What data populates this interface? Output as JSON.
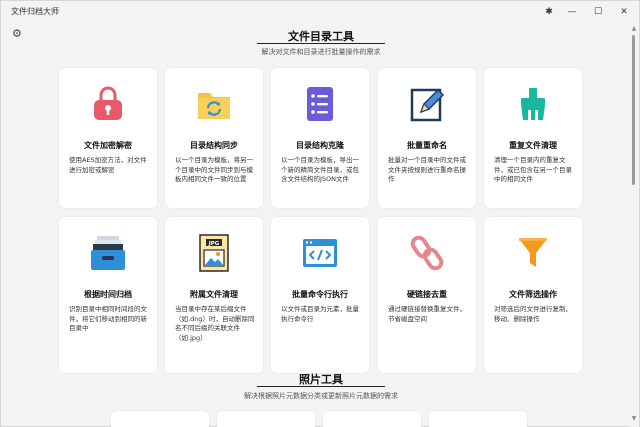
{
  "app": {
    "title": "文件归档大师"
  },
  "window_controls": {
    "pin": "✱",
    "minimize": "—",
    "maximize": "☐",
    "close": "✕"
  },
  "section1": {
    "title": "文件目录工具",
    "subtitle": "解决对文件和目录进行批量操作的需求"
  },
  "section2": {
    "title": "照片工具",
    "subtitle": "解决根据照片元数据分类或更新照片元数据的需求"
  },
  "cards": [
    {
      "name": "文件加密解密",
      "desc": "使用AES加密方法，对文件进行加密或解密"
    },
    {
      "name": "目录结构同步",
      "desc": "以一个目录为模板，将另一个目录中的文件同步到与模板内相同文件一致的位置"
    },
    {
      "name": "目录结构克隆",
      "desc": "以一个目录为模板，导出一个新的精简文件目录，或包含文件结构的JSON文件"
    },
    {
      "name": "批量重命名",
      "desc": "批量对一个目录中的文件或文件夹按规则进行重命名操作"
    },
    {
      "name": "重复文件清理",
      "desc": "清理一个目录内的重复文件，或已包含在另一个目录中的相同文件"
    },
    {
      "name": "根据时间归档",
      "desc": "识别目录中相同时间段的文件，将它们移动到相同的新目录中"
    },
    {
      "name": "附属文件清理",
      "desc": "当目录中存在某后缀文件（如.dng）时，自动删除同名不同后缀的关联文件（如.jpg）"
    },
    {
      "name": "批量命令行执行",
      "desc": "以文件或目录为元素，批量执行命令行"
    },
    {
      "name": "硬链接去重",
      "desc": "通过硬链接替换重复文件，节省磁盘空间"
    },
    {
      "name": "文件筛选操作",
      "desc": "对筛选后的文件进行复制、移动、删除操作"
    }
  ],
  "icons": {
    "c0": "lock-icon",
    "c1": "folder-sync-icon",
    "c2": "list-icon",
    "c3": "pencil-icon",
    "c4": "broom-icon",
    "c5": "archive-drawer-icon",
    "c6": "jpg-file-icon",
    "c7": "code-window-icon",
    "c8": "chain-link-icon",
    "c9": "funnel-icon"
  },
  "colors": {
    "accent_pink": "#e85a6a",
    "folder_yellow": "#f5c242",
    "purple": "#6a5cd8",
    "teal": "#1bb6a0",
    "blue": "#2f8fd8",
    "orange": "#f39a1e"
  }
}
